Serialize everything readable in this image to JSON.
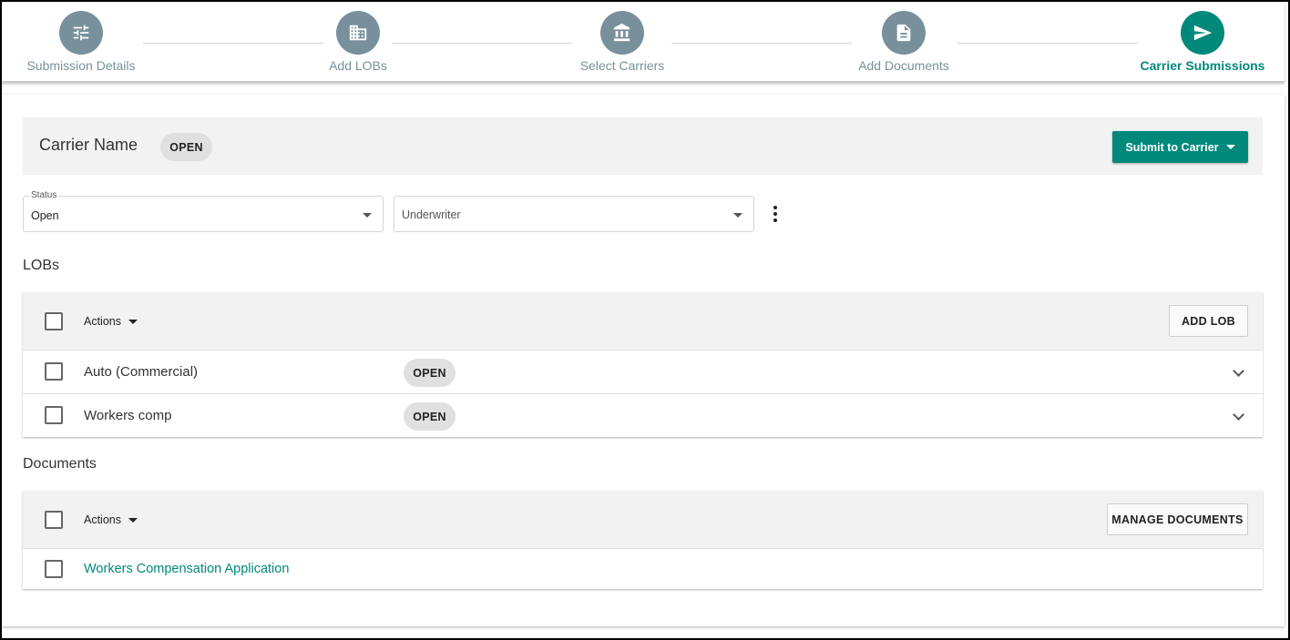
{
  "stepper": {
    "steps": [
      {
        "label": "Submission Details",
        "icon": "tune-icon",
        "active": false
      },
      {
        "label": "Add LOBs",
        "icon": "building-icon",
        "active": false
      },
      {
        "label": "Select Carriers",
        "icon": "bank-icon",
        "active": false
      },
      {
        "label": "Add Documents",
        "icon": "document-icon",
        "active": false
      },
      {
        "label": "Carrier Submissions",
        "icon": "send-icon",
        "active": true
      }
    ]
  },
  "colors": {
    "accent": "#00897b",
    "step_inactive": "#78909c",
    "chip_bg": "#e0e0e0",
    "header_bg": "#f2f2f2"
  },
  "carrier": {
    "name": "Carrier Name",
    "status_chip": "OPEN",
    "submit_label": "Submit to Carrier"
  },
  "filters": {
    "status": {
      "label": "Status",
      "value": "Open"
    },
    "underwriter": {
      "placeholder": "Underwriter"
    }
  },
  "lobs": {
    "title": "LOBs",
    "actions_label": "Actions",
    "add_label": "ADD LOB",
    "rows": [
      {
        "name": "Auto (Commercial)",
        "status": "OPEN"
      },
      {
        "name": "Workers comp",
        "status": "OPEN"
      }
    ]
  },
  "documents": {
    "title": "Documents",
    "actions_label": "Actions",
    "manage_label": "MANAGE DOCUMENTS",
    "rows": [
      {
        "name": "Workers Compensation Application"
      }
    ]
  }
}
